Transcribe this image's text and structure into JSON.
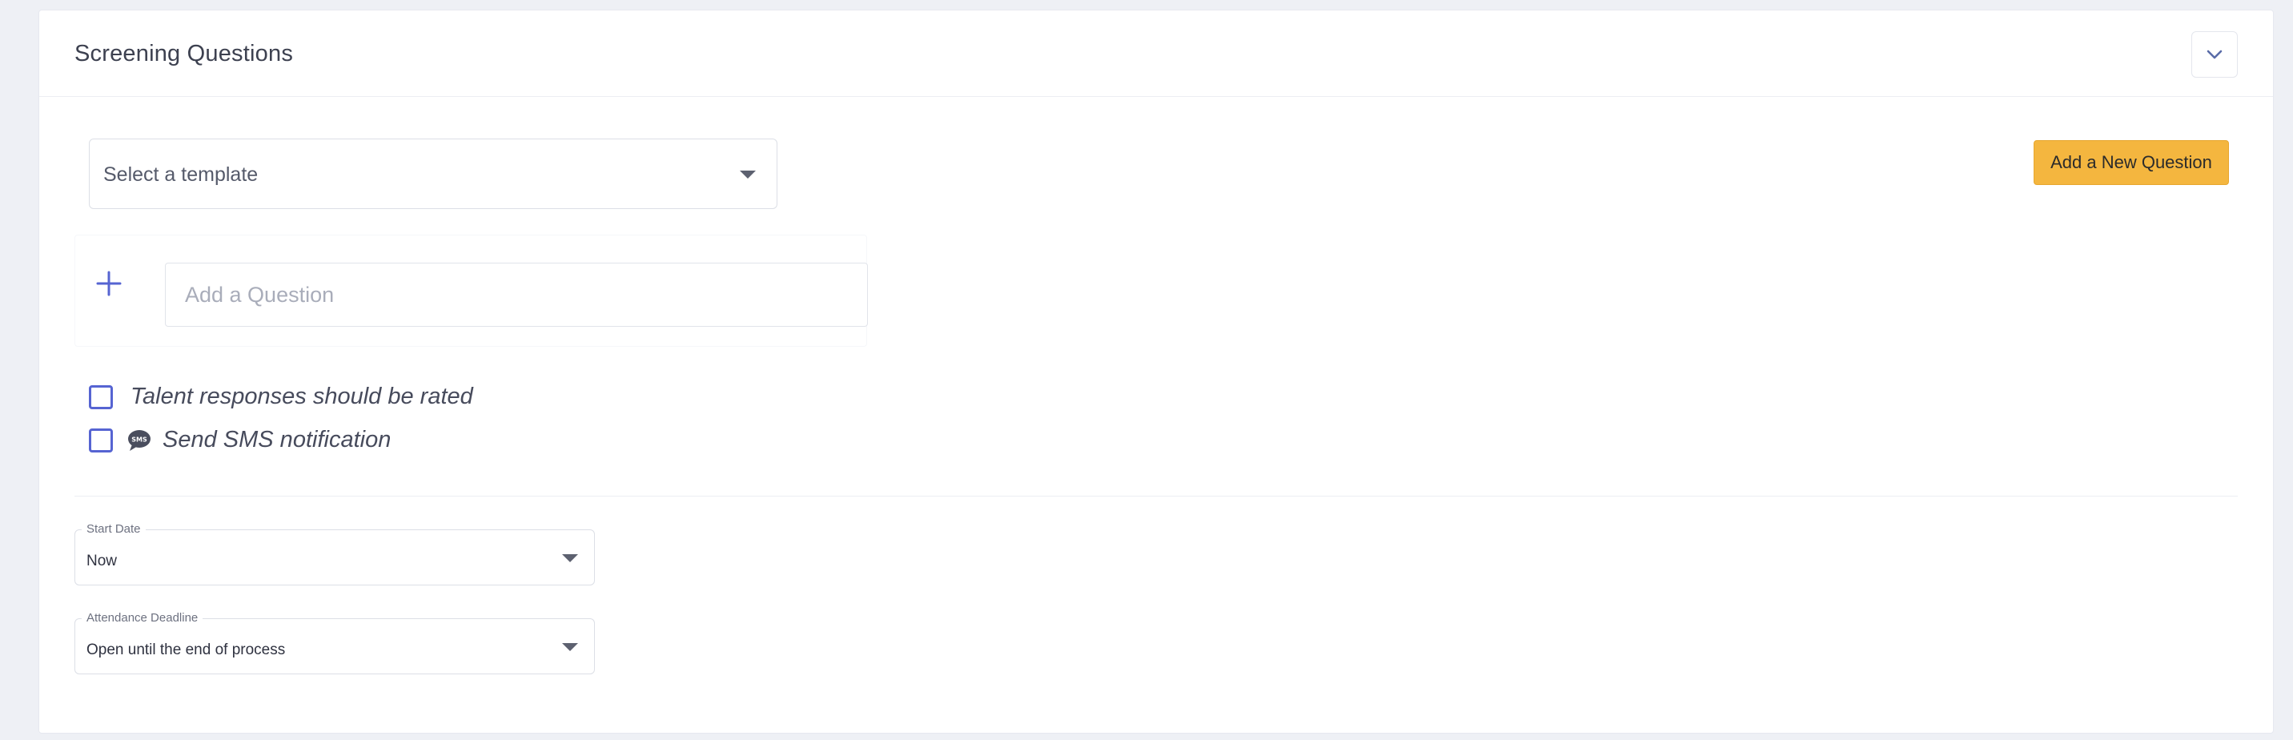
{
  "section": {
    "title": "Screening Questions",
    "collapse_icon": "chevron-down-icon"
  },
  "template": {
    "placeholder": "Select a template"
  },
  "add_new_question_label": "Add a New Question",
  "question_input": {
    "placeholder": "Add a Question",
    "value": ""
  },
  "options": {
    "rated_label": "Talent responses should be rated",
    "rated_checked": false,
    "sms_label": "Send SMS notification",
    "sms_checked": false,
    "sms_icon_text": "SMS"
  },
  "start_date": {
    "label": "Start Date",
    "value": "Now"
  },
  "attendance_deadline": {
    "label": "Attendance Deadline",
    "value": "Open until the end of process"
  },
  "colors": {
    "accent": "#5664d2",
    "button": "#f4b63f",
    "background": "#eef0f5"
  }
}
